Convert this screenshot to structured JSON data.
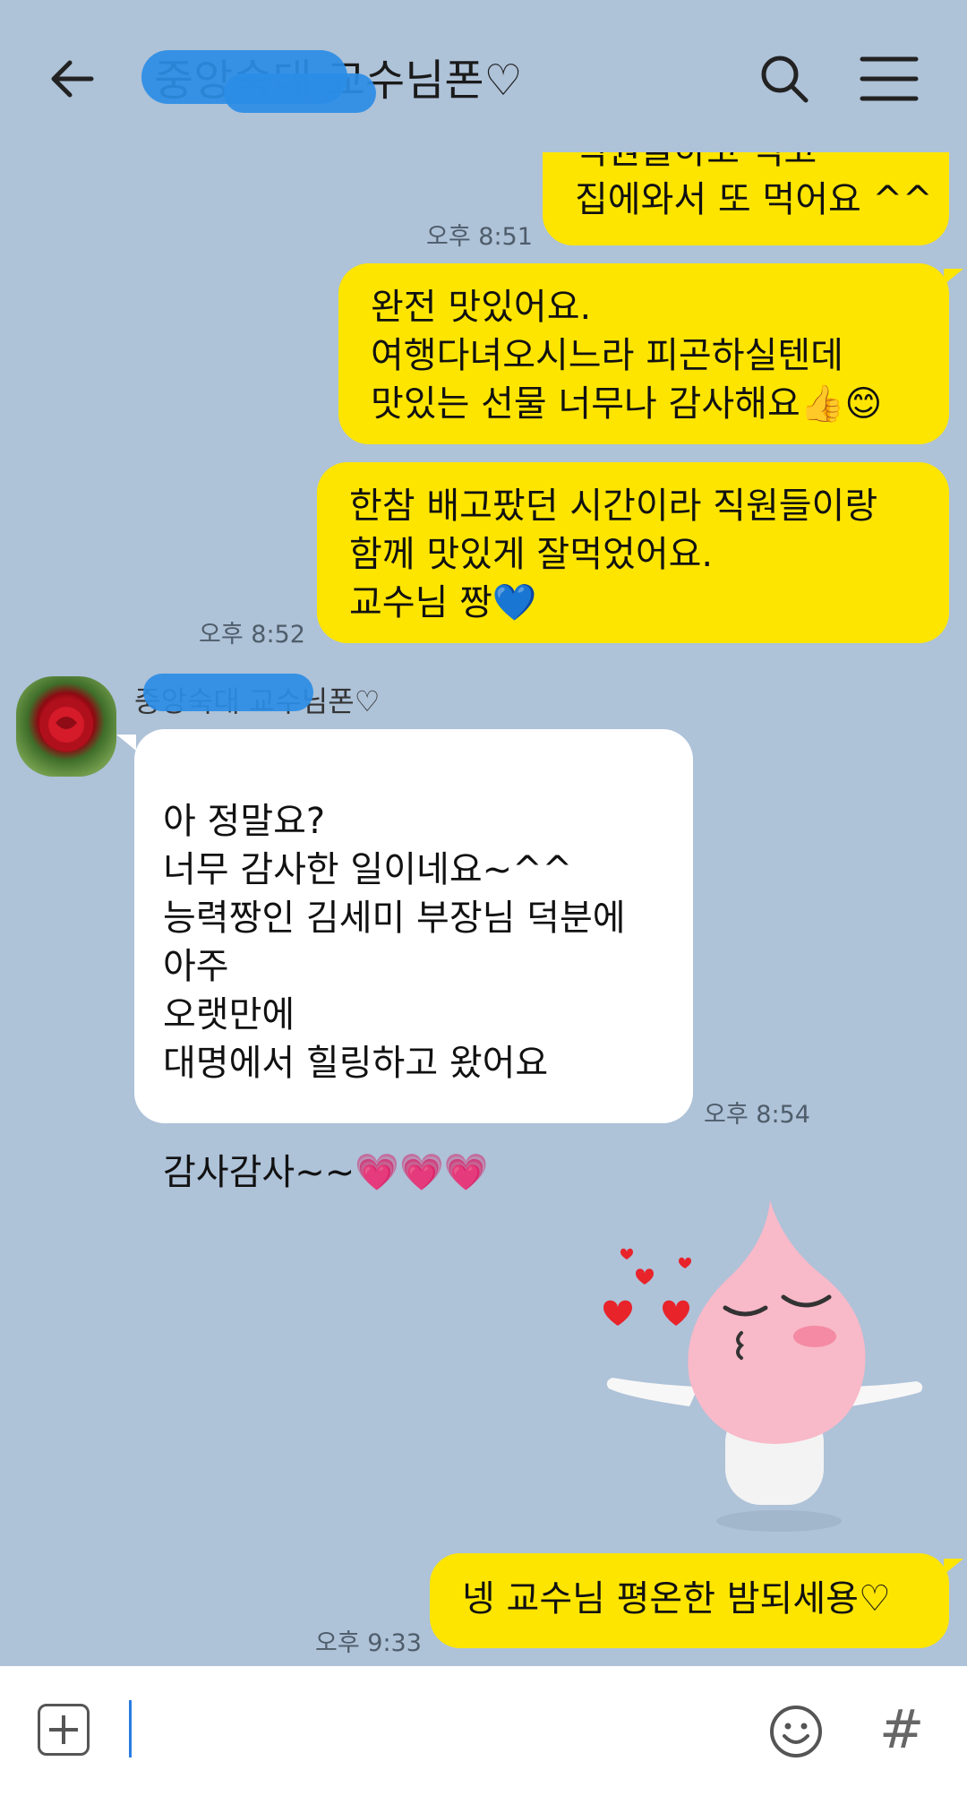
{
  "header": {
    "title": "중앙숙대 교수님폰♡",
    "back_icon": "arrow-left-icon",
    "search_icon": "search-icon",
    "menu_icon": "hamburger-menu-icon"
  },
  "messages": [
    {
      "text": "직원들하고 먹고\n집에와서 또 먹어요 ^^",
      "time": "오후 8:51"
    },
    {
      "text": "완전 맛있어요.\n여행다녀오시느라 피곤하실텐데\n맛있는 선물 너무나 감사해요👍😊"
    },
    {
      "text": "한참 배고팠던 시간이라 직원들이랑\n함께 맛있게 잘먹었어요.\n교수님 짱💙",
      "time": "오후 8:52"
    },
    {
      "sender": "중앙숙대 교수님폰♡",
      "text": "아 정말요?\n너무 감사한 일이네요~^^\n능력짱인 김세미 부장님 덕분에\n아주\n오랫만에\n대명에서 힐링하고 왔어요",
      "text2": "감사감사~~💗💗💗",
      "time": "오후 8:54"
    },
    {
      "sticker": "kiss-sticker"
    },
    {
      "text": "넹 교수님 평온한 밤되세용♡",
      "time": "오후 9:33"
    }
  ],
  "input": {
    "plus_icon": "plus-icon",
    "emoji_icon": "emoji-icon",
    "hash_label": "#"
  },
  "colors": {
    "background": "#aec2d8",
    "my_bubble": "#fee500",
    "their_bubble": "#ffffff"
  }
}
